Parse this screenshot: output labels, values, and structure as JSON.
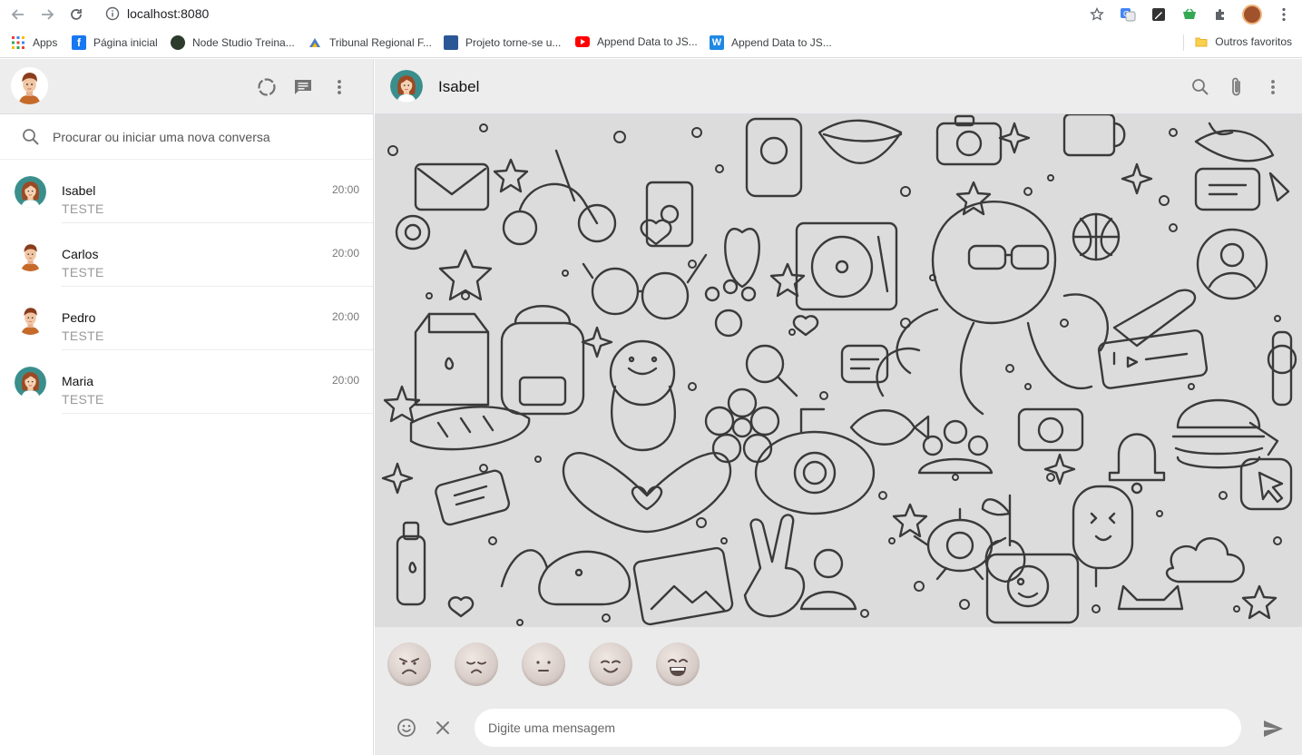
{
  "browser": {
    "url": "localhost:8080",
    "bookmarks": [
      {
        "label": "Apps",
        "color": "#4285f4"
      },
      {
        "label": "Página inicial",
        "color": "#1877f2"
      },
      {
        "label": "Node Studio Treina...",
        "color": "#2d3b2d"
      },
      {
        "label": "Tribunal Regional F...",
        "color": "#4a7cc0"
      },
      {
        "label": "Projeto torne-se u...",
        "color": "#2b5797"
      },
      {
        "label": "Append Data to JS...",
        "color": "#ff0000"
      },
      {
        "label": "Append Data to JS...",
        "color": "#1e88e5"
      }
    ],
    "other_favorites": "Outros favoritos"
  },
  "sidebar": {
    "search_placeholder": "Procurar ou iniciar uma nova conversa",
    "contacts": [
      {
        "name": "Isabel",
        "time": "20:00",
        "message": "TESTE",
        "avatar": "female"
      },
      {
        "name": "Carlos",
        "time": "20:00",
        "message": "TESTE",
        "avatar": "male"
      },
      {
        "name": "Pedro",
        "time": "20:00",
        "message": "TESTE",
        "avatar": "male"
      },
      {
        "name": "Maria",
        "time": "20:00",
        "message": "TESTE",
        "avatar": "female"
      }
    ]
  },
  "chat": {
    "contact_name": "Isabel",
    "message_placeholder": "Digite uma mensagem",
    "reactions": [
      "angry",
      "sad",
      "neutral",
      "content",
      "happy"
    ]
  },
  "colors": {
    "header_bg": "#ededed",
    "wallpaper_bg": "#dcdcdc",
    "accent_teal": "#3a8f8c",
    "hair_brown": "#9c4a25"
  }
}
